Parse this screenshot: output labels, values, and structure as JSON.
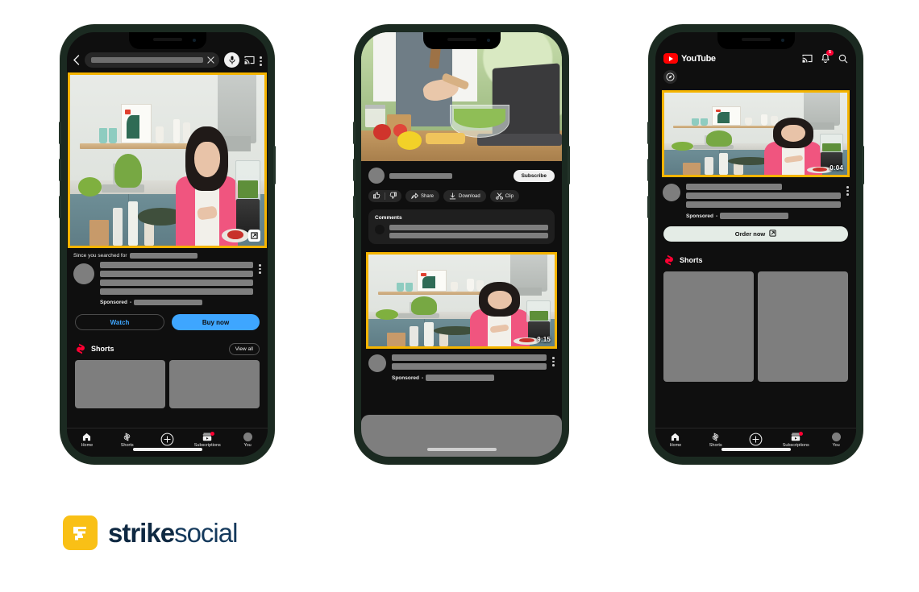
{
  "brand": {
    "name_bold": "strike",
    "name_light": "social",
    "mark_letter": "S",
    "accent": "#f9c016",
    "text_color": "#0f2942"
  },
  "colors": {
    "highlight_frame": "#f5b400",
    "youtube_red": "#ff0000",
    "cta_blue": "#3ea6ff",
    "screen_bg": "#0f0f0f",
    "placeholder_gray": "#7e7e7e",
    "phone_frame": "#1b2a21"
  },
  "phone1": {
    "search": {
      "placeholder": "",
      "back_icon": "back-chevron-icon",
      "clear_icon": "close-icon",
      "mic_icon": "microphone-icon",
      "cast_icon": "cast-icon",
      "more_icon": "more-vertical-icon"
    },
    "video": {
      "expand_icon": "expand-icon",
      "duration": ""
    },
    "ad": {
      "since_label": "Since you searched for",
      "sponsored_label": "Sponsored",
      "sponsored_separator": "-",
      "watch_label": "Watch",
      "buy_label": "Buy now",
      "more_icon": "more-vertical-icon"
    },
    "shorts": {
      "title": "Shorts",
      "view_all": "View all",
      "logo_icon": "shorts-icon"
    },
    "nav": [
      {
        "label": "Home",
        "icon": "home-icon",
        "badge": false
      },
      {
        "label": "Shorts",
        "icon": "shorts-icon",
        "badge": false
      },
      {
        "label": "",
        "icon": "plus-circle-icon",
        "badge": false
      },
      {
        "label": "Subscriptions",
        "icon": "subscriptions-icon",
        "badge": true
      },
      {
        "label": "You",
        "icon": "avatar-icon",
        "badge": false
      }
    ]
  },
  "phone2": {
    "channel": {
      "subscribe_label": "Subscribe"
    },
    "actions": [
      {
        "label": "",
        "icon": "thumbs-up-icon"
      },
      {
        "label": "",
        "icon": "thumbs-down-icon"
      },
      {
        "label": "Share",
        "icon": "share-icon"
      },
      {
        "label": "Download",
        "icon": "download-icon"
      },
      {
        "label": "Clip",
        "icon": "clip-icon"
      }
    ],
    "comments": {
      "title": "Comments"
    },
    "ad": {
      "sponsored_label": "Sponsored",
      "sponsored_separator": "-",
      "duration": "9:15",
      "more_icon": "more-vertical-icon"
    }
  },
  "phone3": {
    "header": {
      "logo_text": "YouTube",
      "cast_icon": "cast-icon",
      "bell_icon": "notifications-bell-icon",
      "bell_badge": "5",
      "search_icon": "search-icon",
      "compass_icon": "compass-icon"
    },
    "ad": {
      "duration": "0:04",
      "sponsored_label": "Sponsored",
      "sponsored_separator": "-",
      "order_label": "Order now",
      "order_icon": "external-link-icon",
      "more_icon": "more-vertical-icon"
    },
    "shorts": {
      "title": "Shorts",
      "logo_icon": "shorts-icon"
    },
    "nav": [
      {
        "label": "Home",
        "icon": "home-icon",
        "badge": false
      },
      {
        "label": "Shorts",
        "icon": "shorts-icon",
        "badge": false
      },
      {
        "label": "",
        "icon": "plus-circle-icon",
        "badge": false
      },
      {
        "label": "Subscriptions",
        "icon": "subscriptions-icon",
        "badge": true
      },
      {
        "label": "You",
        "icon": "avatar-icon",
        "badge": false
      }
    ]
  }
}
